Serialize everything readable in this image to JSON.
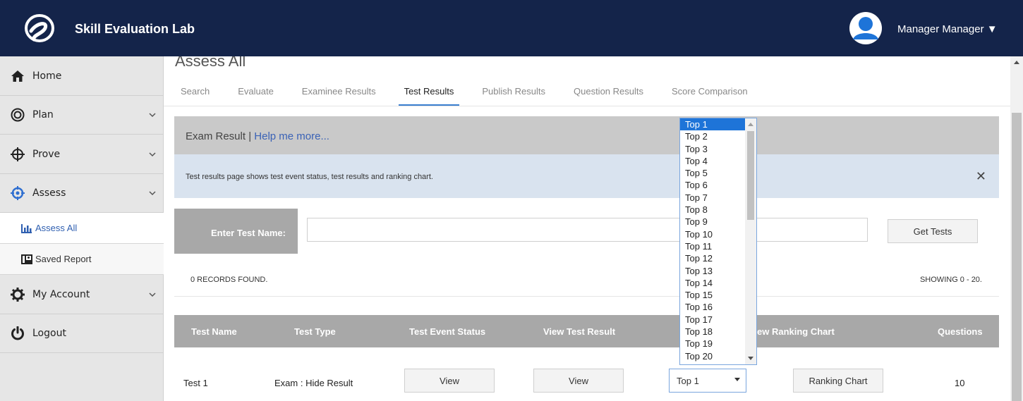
{
  "header": {
    "logo_icon": "e-script-logo-icon",
    "app_title": "Skill Evaluation Lab",
    "avatar_icon": "user-avatar-icon",
    "user_name": "Manager Manager ▼"
  },
  "sidebar": {
    "items": [
      {
        "label": "Home",
        "icon": "home-icon"
      },
      {
        "label": "Plan",
        "icon": "target-ring-icon"
      },
      {
        "label": "Prove",
        "icon": "crosshair-icon"
      },
      {
        "label": "Assess",
        "icon": "assess-target-icon"
      },
      {
        "label": "My Account",
        "icon": "gear-icon"
      },
      {
        "label": "Logout",
        "icon": "power-icon"
      }
    ],
    "sub_items": [
      {
        "label": "Assess All",
        "icon": "bar-chart-icon"
      },
      {
        "label": "Saved Report",
        "icon": "report-icon"
      }
    ]
  },
  "main": {
    "page_title": "Assess All",
    "tabs": [
      {
        "label": "Search"
      },
      {
        "label": "Evaluate"
      },
      {
        "label": "Examinee Results"
      },
      {
        "label": "Test Results"
      },
      {
        "label": "Publish Results"
      },
      {
        "label": "Question Results"
      },
      {
        "label": "Score Comparison"
      }
    ],
    "active_tab": "Test Results",
    "panel": {
      "title": "Exam Result | ",
      "help_link": "Help me more...",
      "info_text": "Test results page shows test event status, test results and ranking chart.",
      "close_glyph": "✕"
    },
    "search": {
      "label": "Enter Test Name:",
      "value": "",
      "button": "Get Tests"
    },
    "records_found": "0 RECORDS FOUND.",
    "showing": "SHOWING 0 - 20.",
    "table": {
      "headers": [
        "Test Name",
        "Test Type",
        "Test Event Status",
        "View Test Result",
        "ew Ranking Chart",
        "Questions"
      ],
      "rows": [
        {
          "test_name": "Test 1",
          "test_type": "Exam : Hide Result",
          "event_status_button": "View",
          "view_result_button": "View",
          "top_select": "Top 1",
          "ranking_button": "Ranking Chart",
          "questions": "10"
        }
      ]
    },
    "dropdown_options": [
      "Top 1",
      "Top 2",
      "Top 3",
      "Top 4",
      "Top 5",
      "Top 6",
      "Top 7",
      "Top 8",
      "Top 9",
      "Top 10",
      "Top 11",
      "Top 12",
      "Top 13",
      "Top 14",
      "Top 15",
      "Top 16",
      "Top 17",
      "Top 18",
      "Top 19",
      "Top 20"
    ],
    "dropdown_selected": "Top 1"
  },
  "colors": {
    "header_bg": "#14244a",
    "sidebar_bg": "#e6e6e6",
    "accent_blue": "#3a7fd0",
    "selected_option": "#1e74d8",
    "table_header_bg": "#a8a8a8",
    "info_bar_bg": "#d9e3ef"
  }
}
